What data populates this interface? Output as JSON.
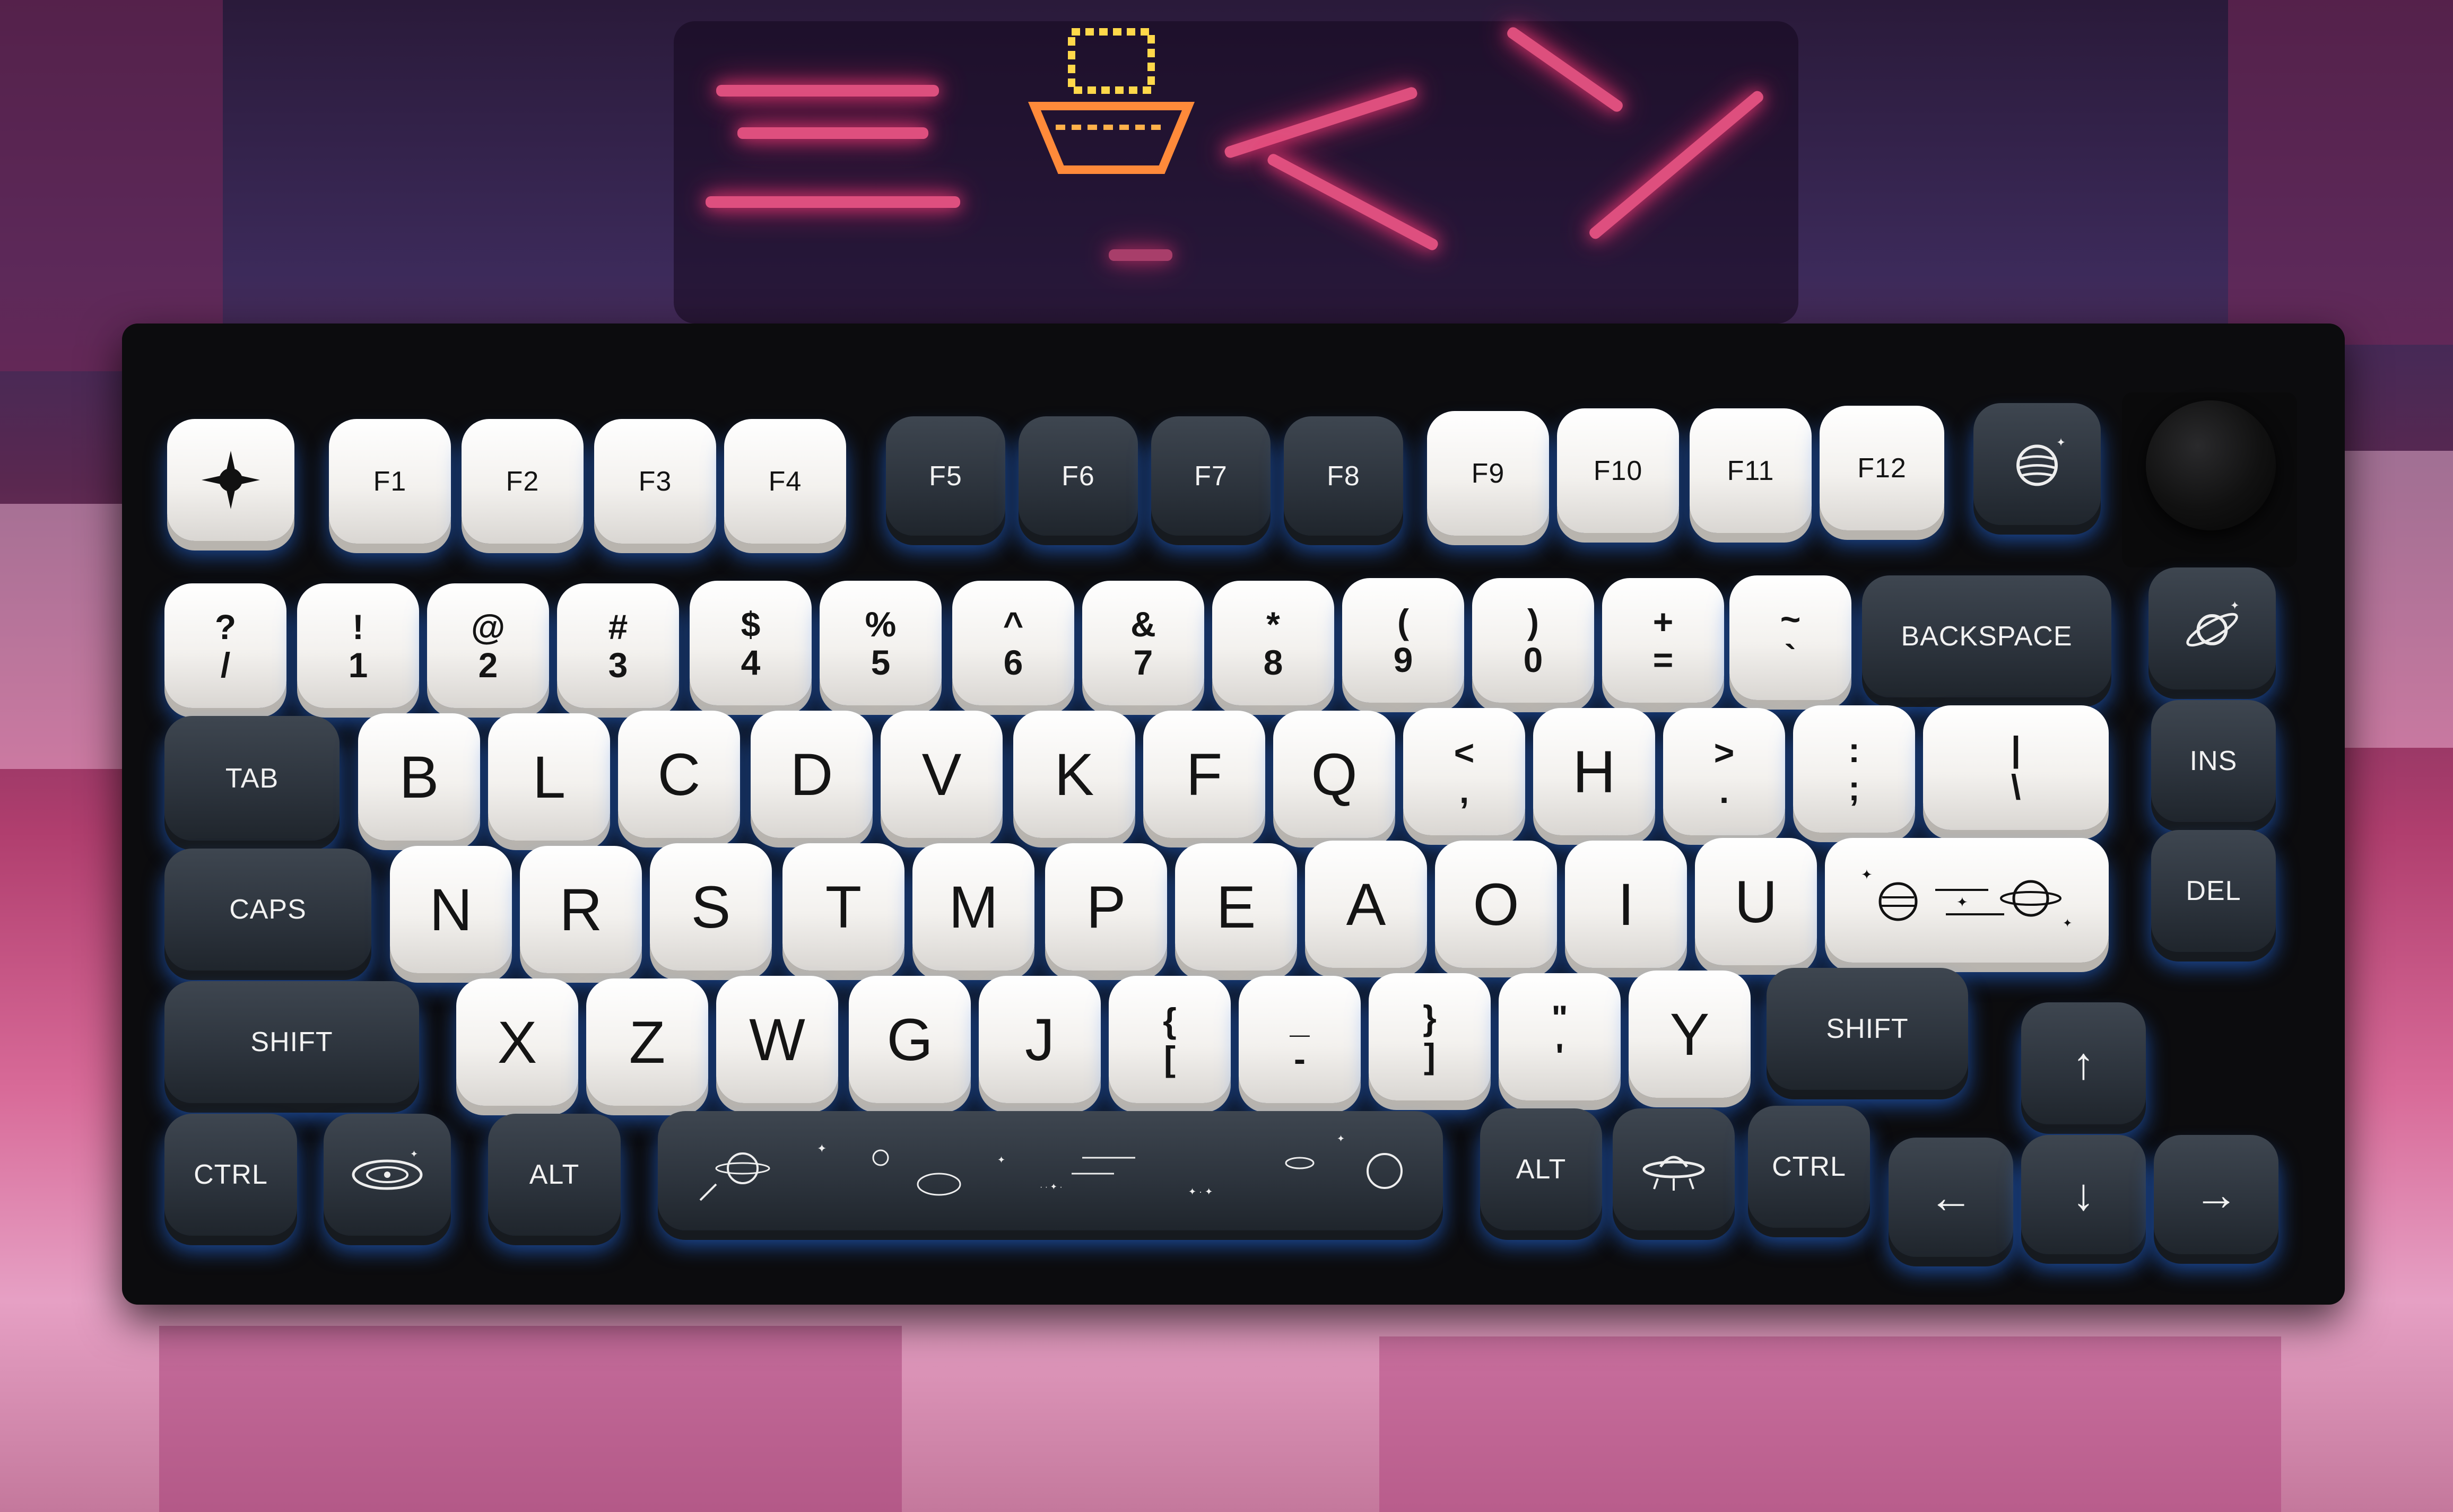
{
  "colors": {
    "cap_white": "#f3f1ee",
    "cap_dark": "#2c333c",
    "backlight": "#2878ff",
    "case": "#0c0c0e",
    "neon": "#ff5a8c"
  },
  "keys": {
    "esc_icon": "compass-star-icon",
    "f1": "F1",
    "f2": "F2",
    "f3": "F3",
    "f4": "F4",
    "f5": "F5",
    "f6": "F6",
    "f7": "F7",
    "f8": "F8",
    "f9": "F9",
    "f10": "F10",
    "f11": "F11",
    "f12": "F12",
    "planet_icon": "planet-icon",
    "num": [
      {
        "top": "?",
        "bot": "/"
      },
      {
        "top": "!",
        "bot": "1"
      },
      {
        "top": "@",
        "bot": "2"
      },
      {
        "top": "#",
        "bot": "3"
      },
      {
        "top": "$",
        "bot": "4"
      },
      {
        "top": "%",
        "bot": "5"
      },
      {
        "top": "^",
        "bot": "6"
      },
      {
        "top": "&",
        "bot": "7"
      },
      {
        "top": "*",
        "bot": "8"
      },
      {
        "top": "(",
        "bot": "9"
      },
      {
        "top": ")",
        "bot": "0"
      },
      {
        "top": "+",
        "bot": "="
      },
      {
        "top": "~",
        "bot": "`"
      }
    ],
    "backspace": "BACKSPACE",
    "saturn_icon": "saturn-icon",
    "tab": "TAB",
    "row_top": [
      "B",
      "L",
      "C",
      "D",
      "V",
      "K",
      "F",
      "Q"
    ],
    "lt": {
      "top": "<",
      "bot": ","
    },
    "h": "H",
    "gt": {
      "top": ">",
      "bot": "."
    },
    "colon": {
      "top": ":",
      "bot": ";"
    },
    "pipe": {
      "top": "|",
      "bot": "\\"
    },
    "ins": "INS",
    "caps": "CAPS",
    "row_home": [
      "N",
      "R",
      "S",
      "T",
      "M",
      "P",
      "E",
      "A",
      "O",
      "I",
      "U"
    ],
    "enter_icon": "space-scene-icon",
    "del": "DEL",
    "shift_l": "SHIFT",
    "row_bottom": [
      "X",
      "Z",
      "W",
      "G",
      "J"
    ],
    "brace_l": {
      "top": "{",
      "bot": "["
    },
    "dash": {
      "top": "_",
      "bot": "-"
    },
    "brace_r": {
      "top": "}",
      "bot": "]"
    },
    "quote": {
      "top": "\"",
      "bot": "'"
    },
    "y": "Y",
    "shift_r": "SHIFT",
    "arrow_up": "↑",
    "ctrl_l": "CTRL",
    "galaxy_icon": "galaxy-icon",
    "alt_l": "ALT",
    "space_icon": "space-constellation-icon",
    "alt_r": "ALT",
    "ufo_icon": "ufo-icon",
    "ctrl_r": "CTRL",
    "arrow_left": "←",
    "arrow_down": "↓",
    "arrow_right": "→"
  }
}
